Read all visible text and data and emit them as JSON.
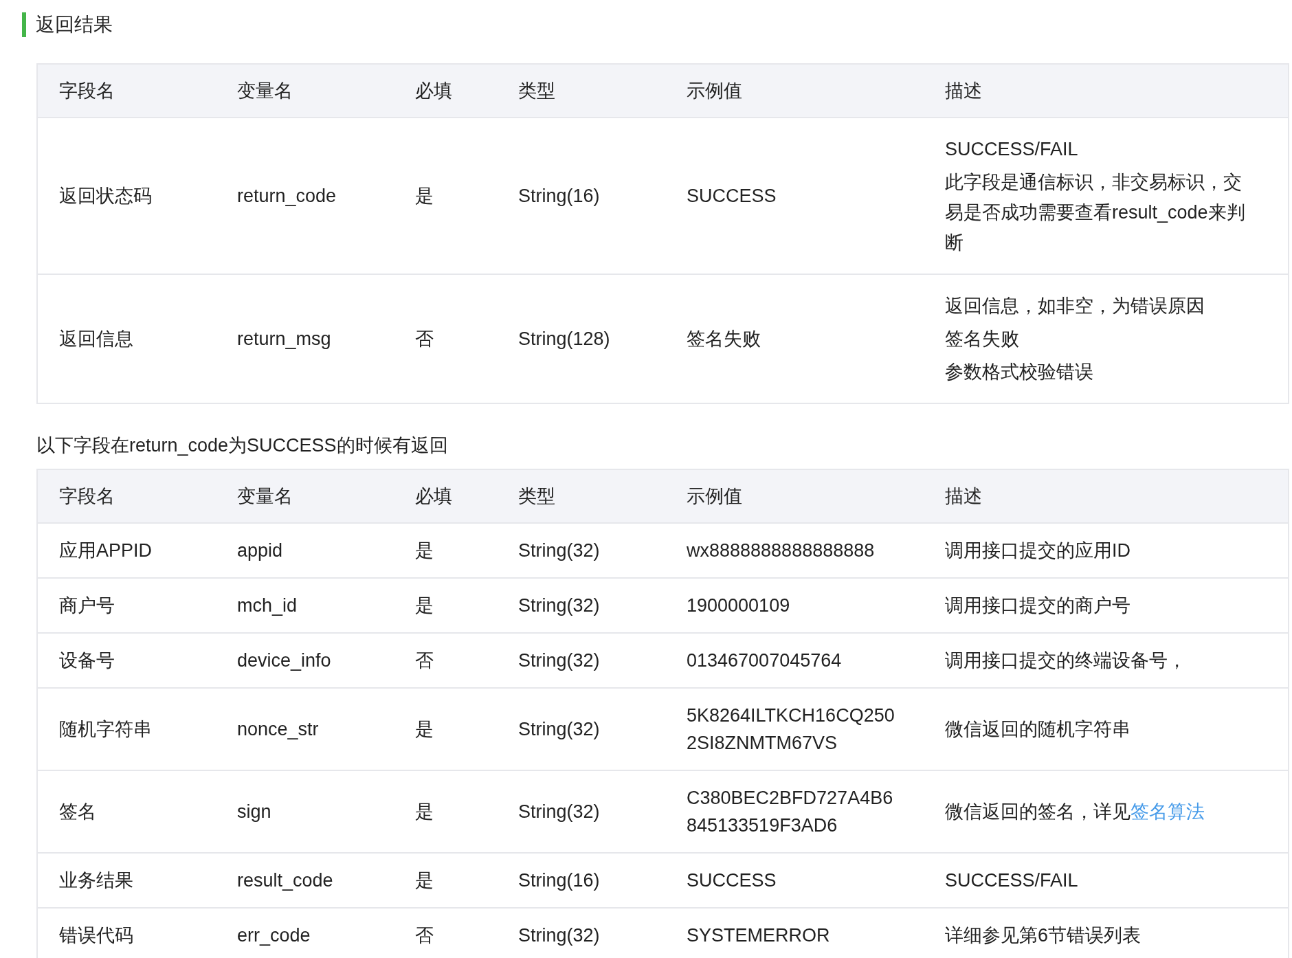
{
  "section_title": "返回结果",
  "table_1": {
    "columns": [
      "字段名",
      "变量名",
      "必填",
      "类型",
      "示例值",
      "描述"
    ],
    "rows": [
      {
        "field": "返回状态码",
        "name": "return_code",
        "required": "是",
        "type": "String(16)",
        "example": [
          "SUCCESS"
        ],
        "description": [
          "SUCCESS/FAIL",
          "此字段是通信标识，非交易标识，交易是否成功需要查看result_code来判断"
        ]
      },
      {
        "field": "返回信息",
        "name": "return_msg",
        "required": "否",
        "type": "String(128)",
        "example": [
          "签名失败"
        ],
        "description": [
          "返回信息，如非空，为错误原因",
          "签名失败",
          "参数格式校验错误"
        ]
      }
    ]
  },
  "note": "以下字段在return_code为SUCCESS的时候有返回",
  "table_2": {
    "columns": [
      "字段名",
      "变量名",
      "必填",
      "类型",
      "示例值",
      "描述"
    ],
    "rows": [
      {
        "field": "应用APPID",
        "name": "appid",
        "required": "是",
        "type": "String(32)",
        "example": [
          "wx8888888888888888"
        ],
        "description": [
          "调用接口提交的应用ID"
        ]
      },
      {
        "field": "商户号",
        "name": "mch_id",
        "required": "是",
        "type": "String(32)",
        "example": [
          "1900000109"
        ],
        "description": [
          "调用接口提交的商户号"
        ]
      },
      {
        "field": "设备号",
        "name": "device_info",
        "required": "否",
        "type": "String(32)",
        "example": [
          "013467007045764"
        ],
        "description": [
          "调用接口提交的终端设备号，"
        ]
      },
      {
        "field": "随机字符串",
        "name": "nonce_str",
        "required": "是",
        "type": "String(32)",
        "example": [
          "5K8264ILTKCH16CQ250",
          "2SI8ZNMTM67VS"
        ],
        "description": [
          "微信返回的随机字符串"
        ]
      },
      {
        "field": "签名",
        "name": "sign",
        "required": "是",
        "type": "String(32)",
        "example": [
          "C380BEC2BFD727A4B6",
          "845133519F3AD6"
        ],
        "description": [
          "微信返回的签名，详见"
        ],
        "link": "签名算法"
      },
      {
        "field": "业务结果",
        "name": "result_code",
        "required": "是",
        "type": "String(16)",
        "example": [
          "SUCCESS"
        ],
        "description": [
          "SUCCESS/FAIL"
        ]
      },
      {
        "field": "错误代码",
        "name": "err_code",
        "required": "否",
        "type": "String(32)",
        "example": [
          "SYSTEMERROR"
        ],
        "description": [
          "详细参见第6节错误列表"
        ]
      }
    ]
  }
}
